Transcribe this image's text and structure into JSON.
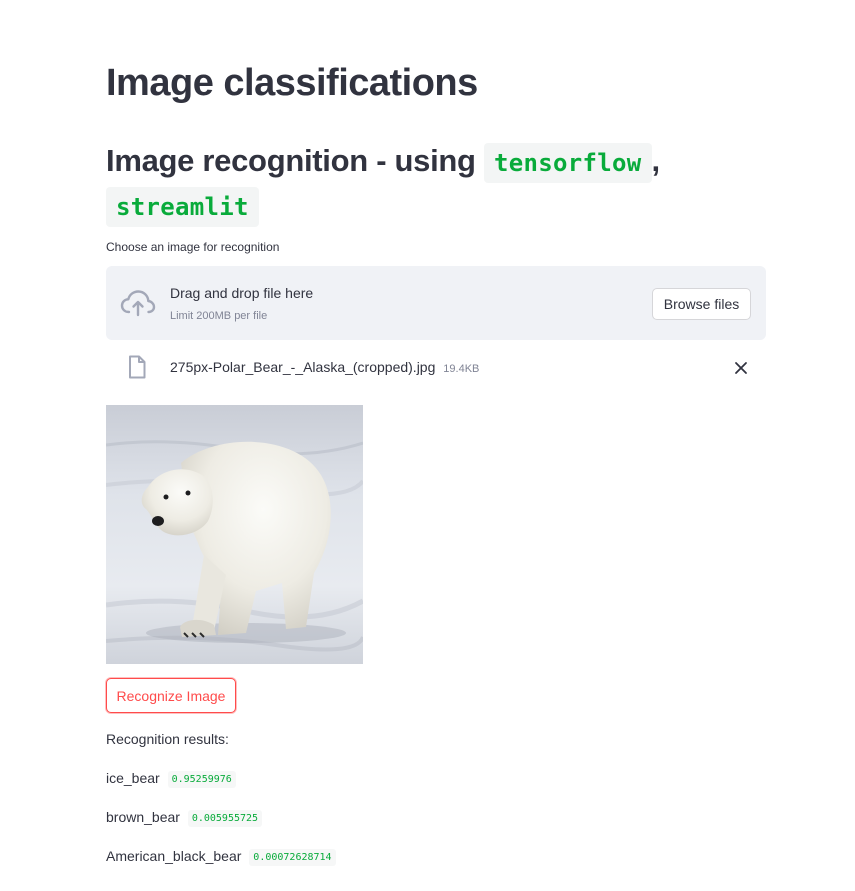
{
  "page": {
    "title": "Image classifications",
    "subtitle_prefix": "Image recognition - using",
    "subtitle_code_1": "tensorflow",
    "subtitle_separator": ",",
    "subtitle_code_2": "streamlit"
  },
  "uploader": {
    "label": "Choose an image for recognition",
    "drop_text": "Drag and drop file here",
    "limit_text": "Limit 200MB per file",
    "browse_label": "Browse files",
    "file_name": "275px-Polar_Bear_-_Alaska_(cropped).jpg",
    "file_size": "19.4KB"
  },
  "actions": {
    "recognize_label": "Recognize Image"
  },
  "results": {
    "heading": "Recognition results:",
    "items": [
      {
        "label": "ice_bear",
        "score": "0.95259976"
      },
      {
        "label": "brown_bear",
        "score": "0.005955725"
      },
      {
        "label": "American_black_bear",
        "score": "0.00072628714"
      }
    ]
  },
  "icons": {
    "upload": "cloud-upload-icon",
    "file": "file-icon",
    "close": "close-icon"
  },
  "colors": {
    "accent": "#ff4b4b",
    "code_green": "#09ab3b",
    "dropzone_bg": "#f0f2f6",
    "text": "#31333f"
  }
}
